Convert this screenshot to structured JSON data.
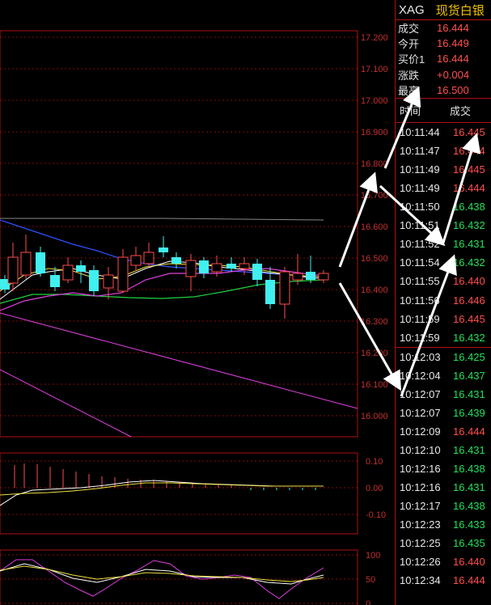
{
  "quote": {
    "symbol": "XAG",
    "name": "现货白银",
    "rows": [
      {
        "label": "成交",
        "value": "16.444"
      },
      {
        "label": "今开",
        "value": "16.449"
      },
      {
        "label": "买价1",
        "value": "16.444"
      },
      {
        "label": "涨跌",
        "value": "+0.004"
      },
      {
        "label": "最高",
        "value": "16.500"
      }
    ]
  },
  "trades": {
    "header_time": "时间",
    "header_price": "成交",
    "rows": [
      {
        "time": "10:11:44",
        "price": "16.445",
        "dir": "up"
      },
      {
        "time": "10:11:47",
        "price": "16.444",
        "dir": "up"
      },
      {
        "time": "10:11:49",
        "price": "16.445",
        "dir": "up"
      },
      {
        "time": "10:11:49",
        "price": "16.444",
        "dir": "up"
      },
      {
        "time": "10:11:50",
        "price": "16.438",
        "dir": "dn"
      },
      {
        "time": "10:11:51",
        "price": "16.432",
        "dir": "dn"
      },
      {
        "time": "10:11:52",
        "price": "16.431",
        "dir": "dn"
      },
      {
        "time": "10:11:54",
        "price": "16.432",
        "dir": "dn"
      },
      {
        "time": "10:11:55",
        "price": "16.440",
        "dir": "up"
      },
      {
        "time": "10:11:56",
        "price": "16.446",
        "dir": "up"
      },
      {
        "time": "10:11:59",
        "price": "16.445",
        "dir": "up"
      },
      {
        "time": "10:11:59",
        "price": "16.432",
        "dir": "dn"
      },
      {
        "time": "10:12:03",
        "price": "16.425",
        "dir": "dn"
      },
      {
        "time": "10:12:04",
        "price": "16.437",
        "dir": "dn"
      },
      {
        "time": "10:12:07",
        "price": "16.431",
        "dir": "dn"
      },
      {
        "time": "10:12:07",
        "price": "16.439",
        "dir": "dn"
      },
      {
        "time": "10:12:09",
        "price": "16.444",
        "dir": "up"
      },
      {
        "time": "10:12:10",
        "price": "16.431",
        "dir": "dn"
      },
      {
        "time": "10:12:16",
        "price": "16.438",
        "dir": "dn"
      },
      {
        "time": "10:12:16",
        "price": "16.431",
        "dir": "dn"
      },
      {
        "time": "10:12:17",
        "price": "16.438",
        "dir": "dn"
      },
      {
        "time": "10:12:23",
        "price": "16.433",
        "dir": "dn"
      },
      {
        "time": "10:12:25",
        "price": "16.435",
        "dir": "dn"
      },
      {
        "time": "10:12:26",
        "price": "16.440",
        "dir": "up"
      },
      {
        "time": "10:12:34",
        "price": "16.444",
        "dir": "up"
      }
    ]
  },
  "price_axis": [
    "17.200",
    "17.100",
    "17.000",
    "16.900",
    "16.800",
    "16.700",
    "16.600",
    "16.500",
    "16.400",
    "16.300",
    "16.200",
    "16.100",
    "16.000"
  ],
  "macd_axis": [
    "0.10",
    "0.00",
    "-0.10"
  ],
  "kdj_axis": [
    "100",
    "50",
    "0"
  ],
  "colors": {
    "up": "#ff4d4d",
    "down": "#22e05a",
    "grid": "#b01010",
    "candle_up": "#ff4d4d",
    "candle_down": "#40f0f0"
  }
}
